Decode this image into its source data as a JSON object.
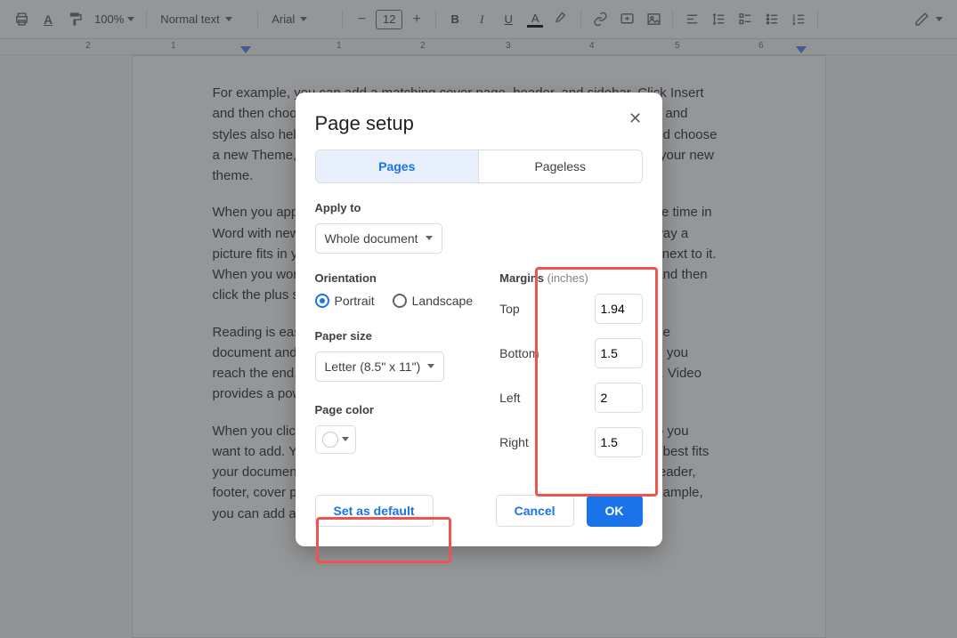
{
  "toolbar": {
    "zoom": "100%",
    "style": "Normal text",
    "font": "Arial",
    "font_size": "12"
  },
  "ruler_ticks": [
    "2",
    "1",
    "1",
    "2",
    "3",
    "4",
    "5",
    "6"
  ],
  "document": {
    "p1": "For example, you can add a matching cover page, header, and sidebar. Click Insert and then choose the elements you want from the different galleries. Themes and styles also help keep your document coordinated. When you click Design and choose a new Theme, the pictures, charts, and SmartArt graphics change to match your new theme.",
    "p2": "When you apply styles, your headings change to match the new theme. Save time in Word with new buttons that show up where you need them. To change the way a picture fits in your document, click it and a button for layout options appears next to it. When you work on a table, click where you want to add a row or a column, and then click the plus sign.",
    "p3": "Reading is easier, too, in the new Reading view. You can collapse parts of the document and focus on the text you want. If you need to stop reading before you reach the end, Word remembers where you left off - even on another device. Video provides a powerful way to help you prove your point.",
    "p4": "When you click Online Video, you can paste in the embed code for the video you want to add. You can also type a keyword to search online for the video that best fits your document. To make your document look professional, Word provides header, footer, cover page, and text box designs that complement each other. For example, you can add a matching cover page, header, and sidebar."
  },
  "dialog": {
    "title": "Page setup",
    "tabs": {
      "pages": "Pages",
      "pageless": "Pageless"
    },
    "apply_to_label": "Apply to",
    "apply_to_value": "Whole document",
    "orientation_label": "Orientation",
    "orientation": {
      "portrait": "Portrait",
      "landscape": "Landscape"
    },
    "paper_size_label": "Paper size",
    "paper_size_value": "Letter (8.5\" x 11\")",
    "page_color_label": "Page color",
    "margins_label": "Margins",
    "inches": "(inches)",
    "margins": {
      "top_label": "Top",
      "top": "1.94",
      "bottom_label": "Bottom",
      "bottom": "1.5",
      "left_label": "Left",
      "left": "2",
      "right_label": "Right",
      "right": "1.5"
    },
    "set_default": "Set as default",
    "cancel": "Cancel",
    "ok": "OK"
  }
}
